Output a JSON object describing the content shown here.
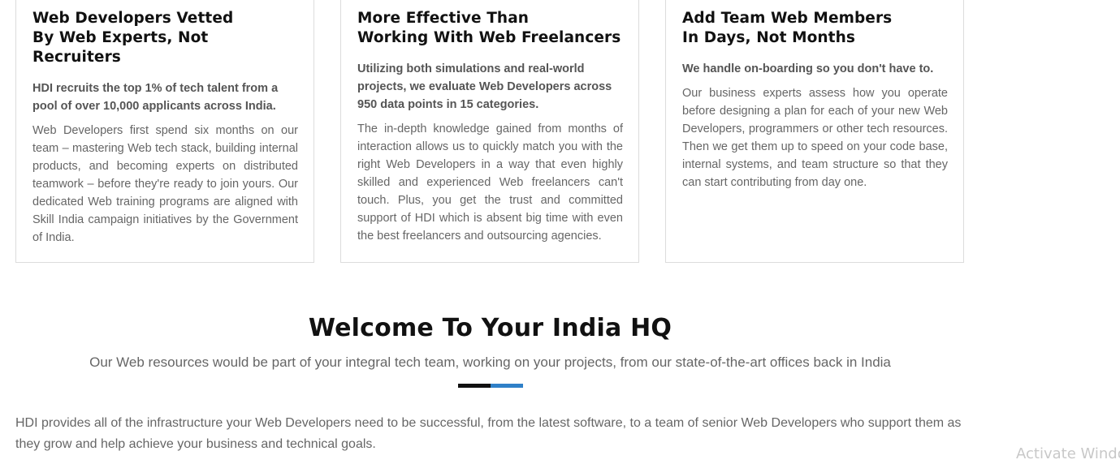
{
  "cards": [
    {
      "title_line1": "Web Developers Vetted",
      "title_line2": "By Web Experts, Not Recruiters",
      "lead": "HDI recruits the top 1% of tech talent from a pool of over 10,000 applicants across India.",
      "body": "Web Developers first spend six months on our team – mastering Web tech stack, building internal products, and becoming experts on distributed teamwork – before they're ready to join yours. Our dedicated Web training programs are aligned with Skill India campaign initiatives by the Government of India."
    },
    {
      "title_line1": "More Effective Than",
      "title_line2": "Working With Web Freelancers",
      "lead": "Utilizing both simulations and real-world projects, we evaluate Web Developers across 950 data points in 15 categories.",
      "body": "The in-depth knowledge gained from months of interaction allows us to quickly match you with the right Web Developers in a way that even highly skilled and experienced Web freelancers can't touch. Plus, you get the trust and committed support of HDI which is absent big time with even the best freelancers and outsourcing agencies."
    },
    {
      "title_line1": "Add Team Web Members",
      "title_line2": "In Days, Not Months",
      "lead": "We handle on-boarding so you don't have to.",
      "body": "Our business experts assess how you operate before designing a plan for each of your new Web Developers, programmers or other tech resources. Then we get them up to speed on your code base, internal systems, and team structure so that they can start contributing from day one."
    }
  ],
  "welcome": {
    "title": "Welcome To Your India HQ",
    "subtitle": "Our Web resources would be part of your integral tech team, working on your projects, from our state-of-the-art offices back in India"
  },
  "divider_colors": [
    "#111111",
    "#2f80c8"
  ],
  "infrastructure_text": "HDI provides all of the infrastructure your Web Developers need to be successful, from the latest software, to a team of senior Web Developers who support them as they grow and help achieve your business and technical goals.",
  "watermark": "Activate Windo"
}
